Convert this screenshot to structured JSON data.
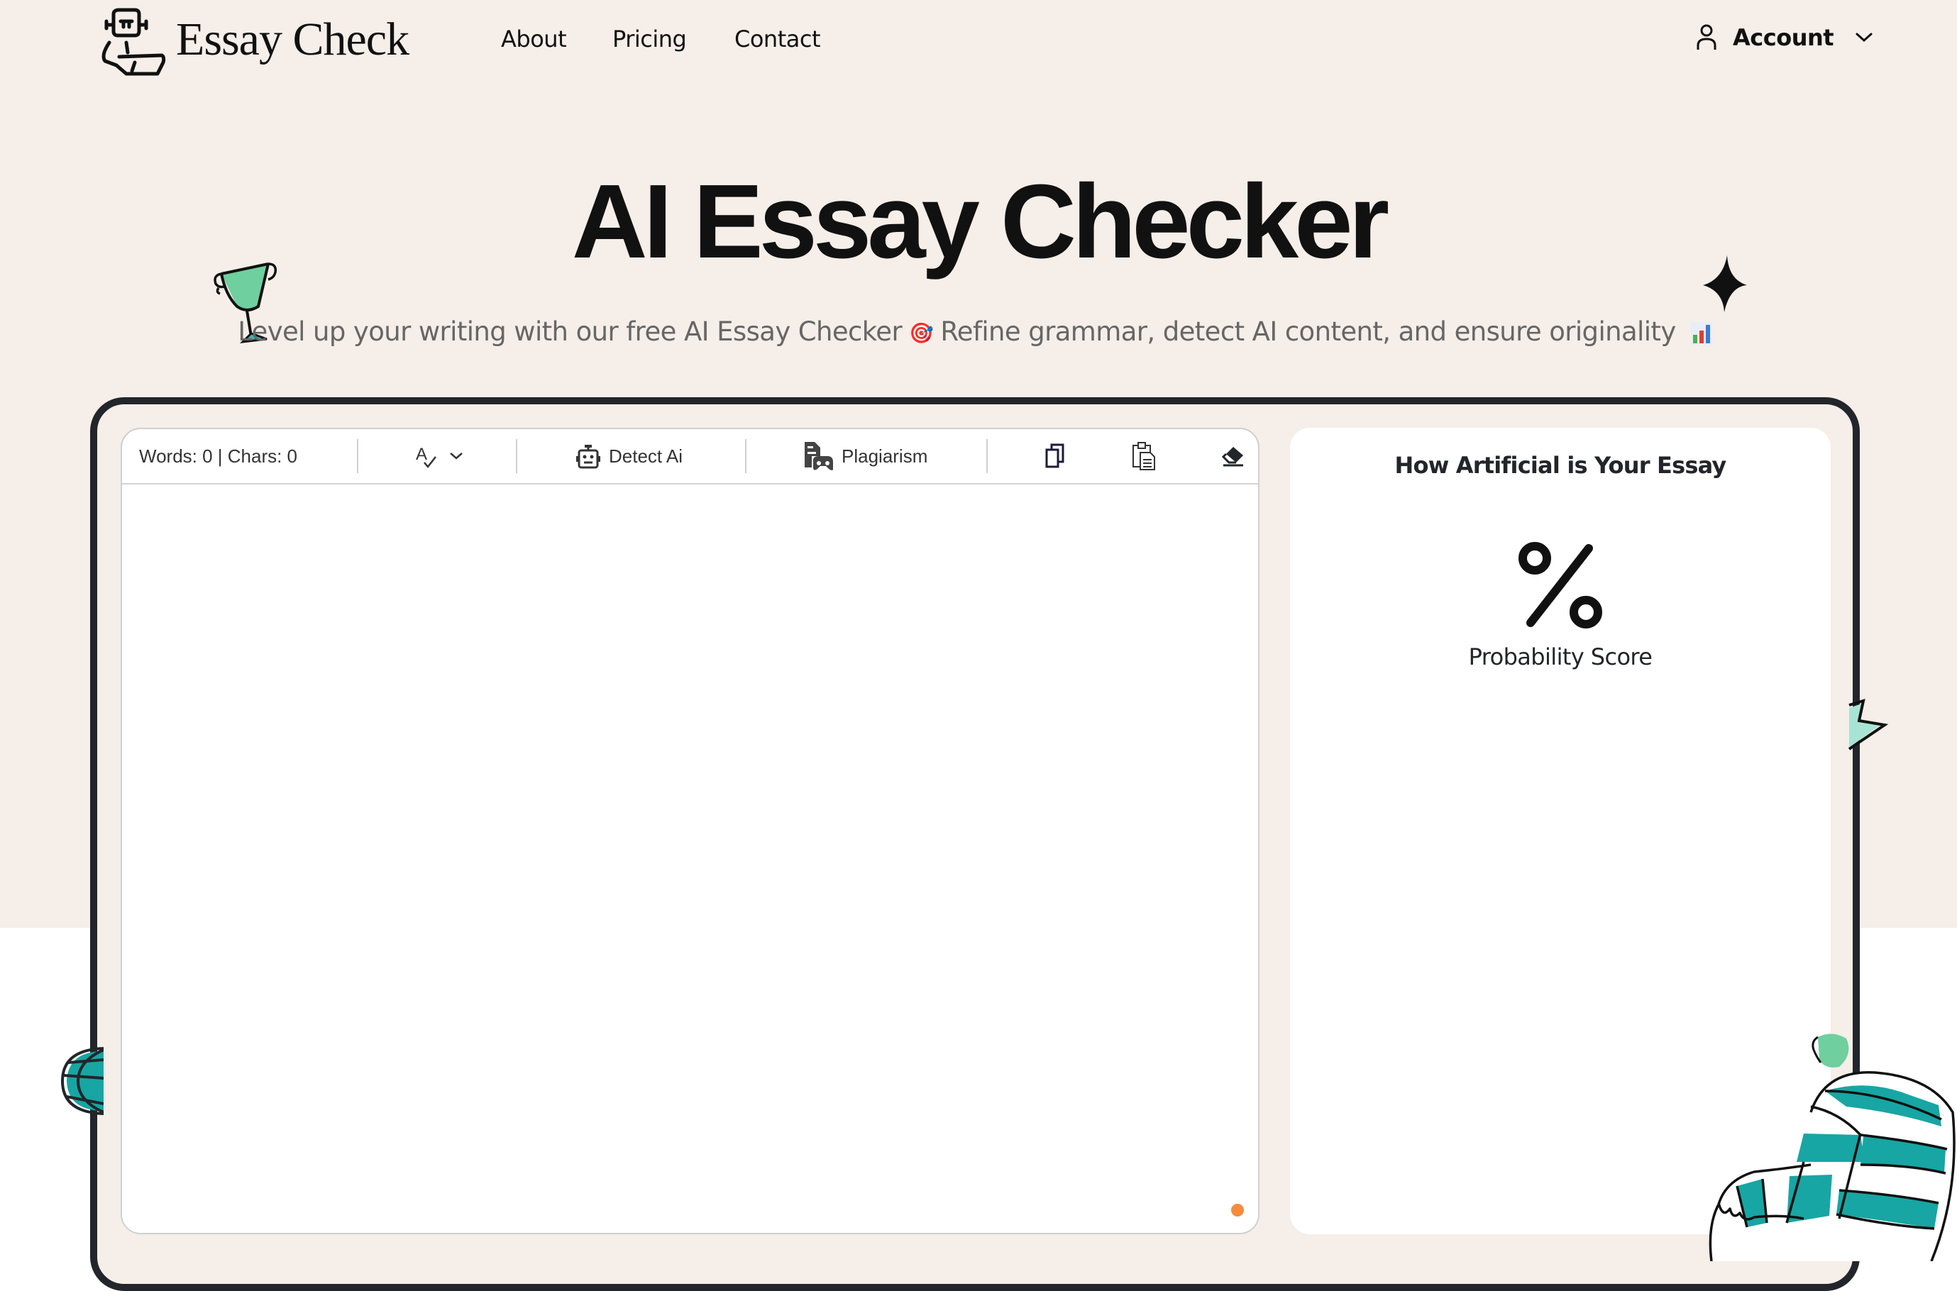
{
  "brand": {
    "name": "Essay Check",
    "logo_icon": "robot-laptop-icon"
  },
  "nav": {
    "items": [
      {
        "label": "About"
      },
      {
        "label": "Pricing"
      },
      {
        "label": "Contact"
      }
    ],
    "account": {
      "label": "Account",
      "icon": "user-icon",
      "chevron": "chevron-down-icon"
    }
  },
  "hero": {
    "title": "AI Essay Checker",
    "subtitle_part1": "Level up your writing with our free AI Essay Checker",
    "subtitle_emoji1": "🎯",
    "subtitle_part2": "Refine grammar, detect AI content, and ensure originality",
    "subtitle_emoji2": "📊"
  },
  "editor": {
    "counter": "Words: 0 | Chars: 0",
    "grammar_icon": "spell-check-icon",
    "detect_ai_label": "Detect Ai",
    "plagiarism_label": "Plagiarism",
    "copy_icon": "copy-icon",
    "paste_icon": "paste-icon",
    "clear_icon": "eraser-icon",
    "text": "",
    "status_color": "#f58b3c"
  },
  "results": {
    "heading": "How Artificial is Your Essay",
    "score_symbol": "%",
    "score_label": "Probability Score"
  },
  "colors": {
    "page_bg": "#f5eee9",
    "frame": "#22262a",
    "accent_teal": "#17a6a3",
    "accent_green": "#6fcf9f"
  }
}
